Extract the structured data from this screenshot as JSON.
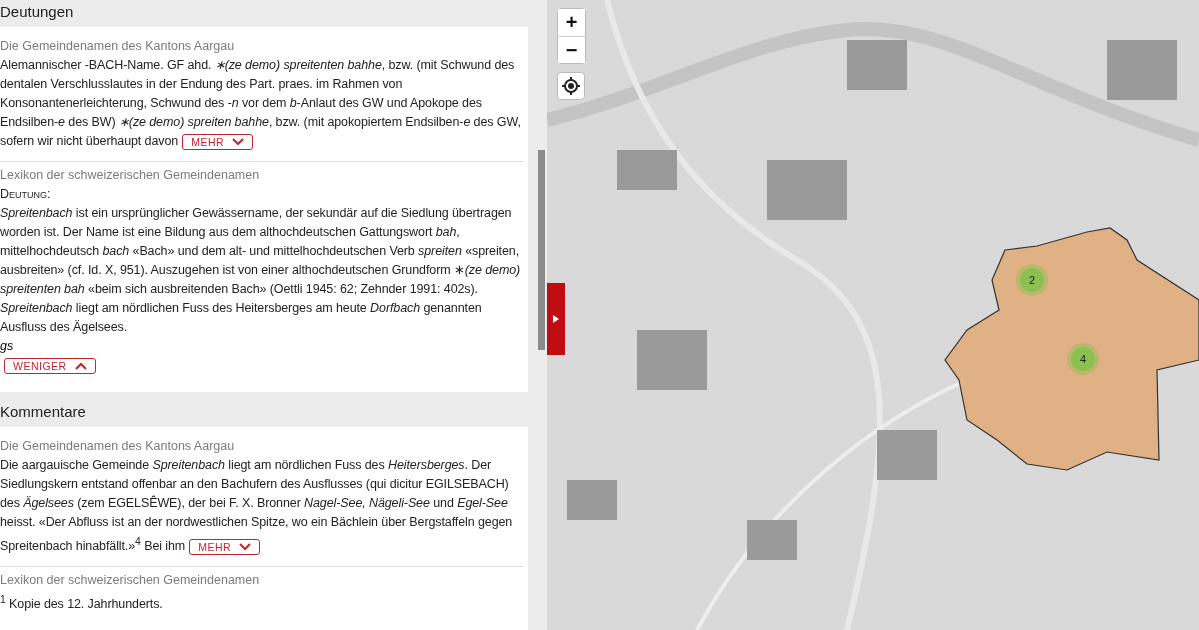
{
  "sections": [
    {
      "title": "Deutungen",
      "entries": [
        {
          "source": "Die Gemeindenamen des Kantons Aargau",
          "text": "Alemannischer -BACH-Name. GF ahd. *∗(ze demo) spreitenten bahhe*, bzw. (mit Schwund des dentalen Verschlusslautes in der Endung des Part. praes. im Rahmen von Konsonantenerleichterung, Schwund des *-n* vor dem *b*-Anlaut des GW und Apokope des Endsilben-*e* des BW) *∗(ze demo) spreiten bahhe*, bzw. (mit apokopiertem Endsilben-*e* des GW, sofern wir nicht überhaupt davon",
          "toggle": {
            "label": "MEHR",
            "expanded": false
          }
        },
        {
          "source": "Lexikon der schweizerischen Gemeindenamen",
          "heading": "Deutung:",
          "text": "*Spreitenbach* ist ein ursprünglicher Gewässername, der sekundär auf die Siedlung übertragen worden ist. Der Name ist eine Bildung aus dem althochdeutschen Gattungswort *bah*, mittelhochdeutsch *bach* «Bach» und dem alt- und mittelhochdeutschen Verb *spreiten* «spreiten, ausbreiten» (cf. Id. X, 951). Auszugehen ist von einer althochdeutschen Grundform ∗*(ze demo) spreitenten bah* «beim sich ausbreitenden Bach» (Oettli 1945: 62; Zehnder 1991: 402s). *Spreitenbach* liegt am nördlichen Fuss des Heitersberges am heute *Dorfbach* genannten Ausfluss des Ägelsees.",
          "signature": "gs",
          "toggle": {
            "label": "WENIGER",
            "expanded": true
          }
        }
      ]
    },
    {
      "title": "Kommentare",
      "entries": [
        {
          "source": "Die Gemeindenamen des Kantons Aargau",
          "text": "Die aargauische Gemeinde *Spreitenbach* liegt am nördlichen Fuss des *Heitersberges*. Der Siedlungskern entstand offenbar an den Bachufern des Ausflusses (qui dicitur EGILSEBACH) des *Ägelsees* (zem EGELSÊWE), der bei F. X. Bronner *Nagel-See, Nägeli-See* und *Egel-See* heisst. «Der Abfluss ist an der nordwestlichen Spitze, wo ein Bächlein über Bergstaffeln gegen Spreitenbach hinabfällt.»$^{4}$ Bei ihm",
          "toggle": {
            "label": "MEHR",
            "expanded": false
          }
        },
        {
          "source": "Lexikon der schweizerischen Gemeindenamen",
          "text": "$^{1}$ Kopie des 12. Jahrhunderts."
        }
      ]
    }
  ],
  "map": {
    "zoom_in": "+",
    "zoom_out": "−",
    "clusters": [
      {
        "count": "2"
      },
      {
        "count": "4"
      }
    ]
  }
}
